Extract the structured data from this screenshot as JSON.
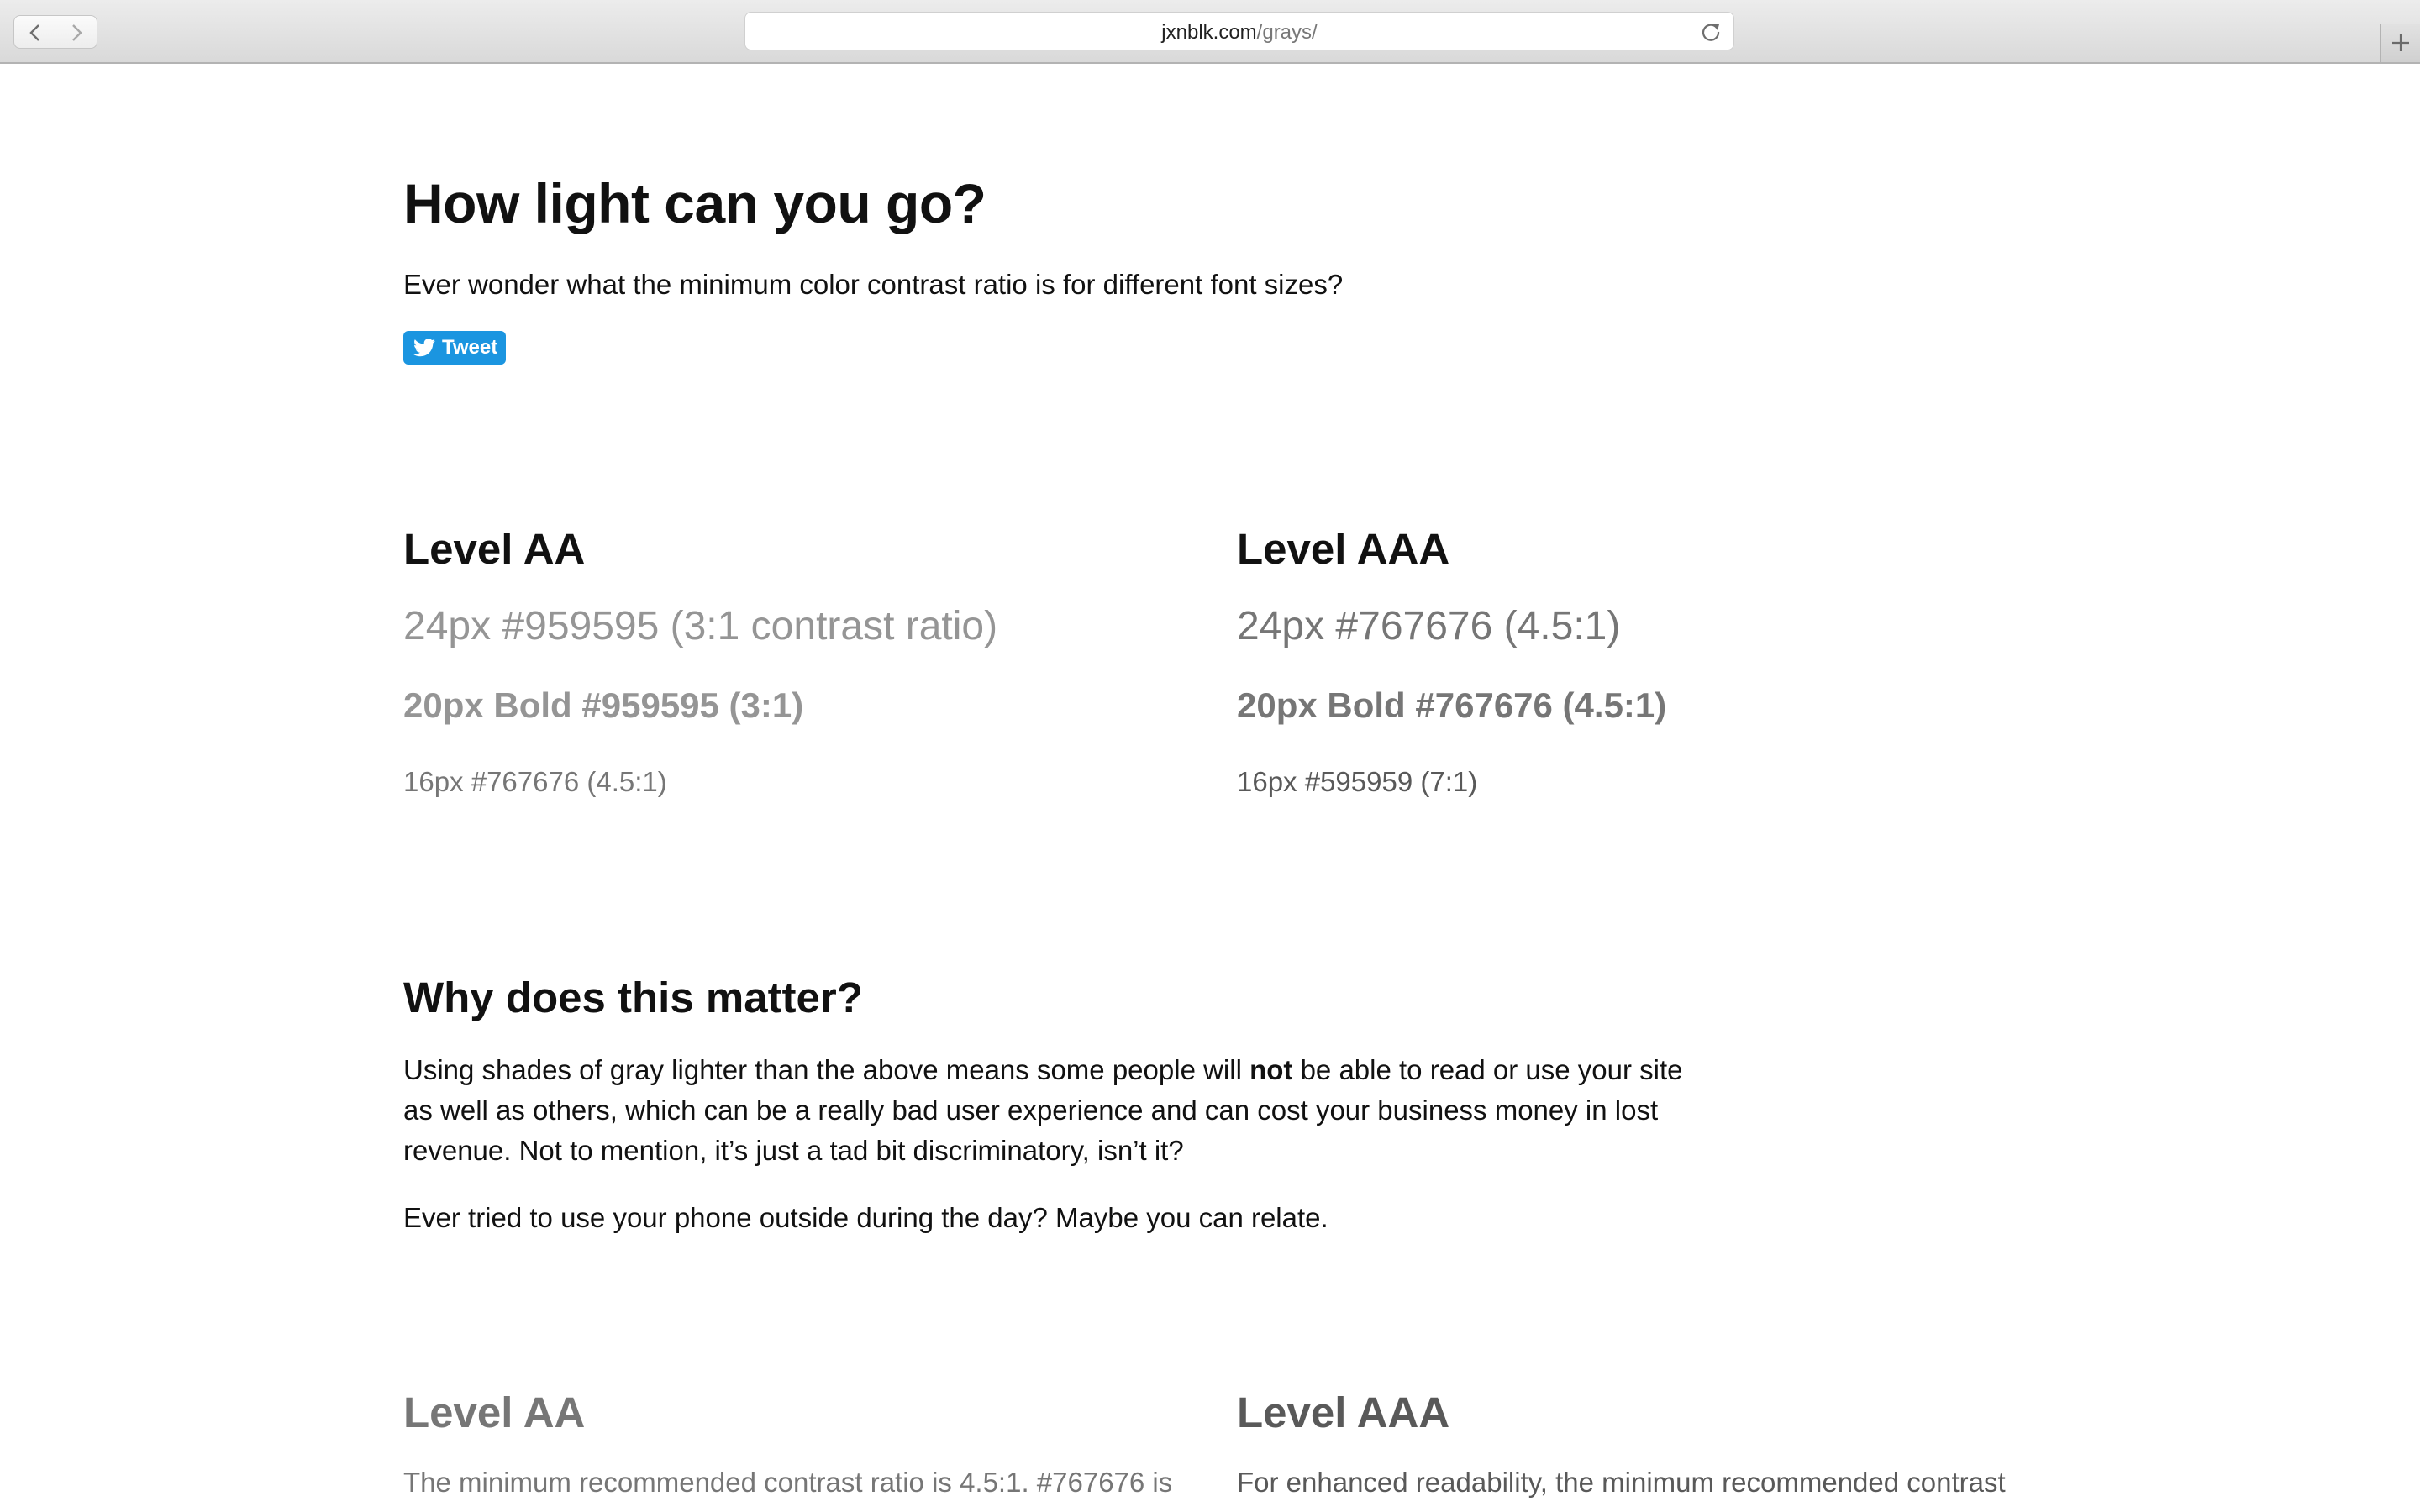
{
  "browser": {
    "url_host": "jxnblk.com",
    "url_path": "/grays/"
  },
  "header": {
    "title": "How light can you go?",
    "subtitle": "Ever wonder what the minimum color contrast ratio is for different font sizes?",
    "tweet_label": "Tweet"
  },
  "levels": {
    "aa": {
      "heading": "Level AA",
      "sample_24": "24px #959595 (3:1 contrast ratio)",
      "sample_20_bold": "20px Bold #959595 (3:1)",
      "sample_16": "16px #767676 (4.5:1)"
    },
    "aaa": {
      "heading": "Level AAA",
      "sample_24": "24px #767676 (4.5:1)",
      "sample_20_bold": "20px Bold #767676 (4.5:1)",
      "sample_16": "16px #595959 (7:1)"
    }
  },
  "why": {
    "title": "Why does this matter?",
    "para1_before": "Using shades of gray lighter than the above means some people will ",
    "para1_strong": "not",
    "para1_after": " be able to read or use your site as well as others, which can be a really bad user experience and can cost your business money in lost revenue. Not to mention, it’s just a tad bit discriminatory, isn’t it?",
    "para2": "Ever tried to use your phone outside during the day? Maybe you can relate."
  },
  "details": {
    "aa": {
      "heading": "Level AA",
      "text": "The minimum recommended contrast ratio is 4.5:1. #767676 is"
    },
    "aaa": {
      "heading": "Level AAA",
      "text": "For enhanced readability, the minimum recommended contrast"
    }
  },
  "colors": {
    "gray_959595": "#959595",
    "gray_767676": "#767676",
    "gray_595959": "#595959",
    "tweet_blue": "#1b95e0"
  },
  "icons": [
    "back-icon",
    "forward-icon",
    "reload-icon",
    "plus-icon",
    "twitter-bird-icon"
  ]
}
